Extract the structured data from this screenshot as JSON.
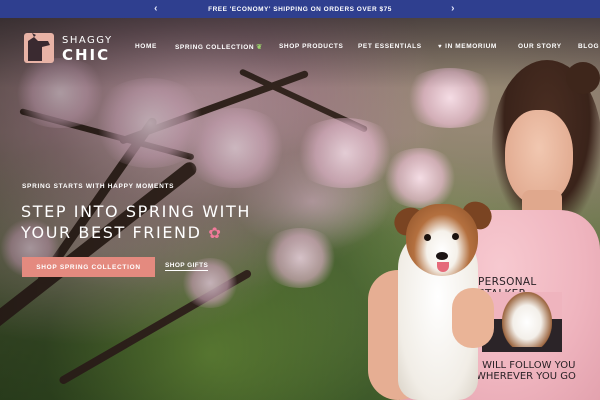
{
  "announcement": {
    "text": "FREE 'ECONOMY' SHIPPING ON ORDERS OVER $75",
    "prev_icon": "chevron-left-icon",
    "next_icon": "chevron-right-icon"
  },
  "brand": {
    "line1": "SHAGGY",
    "line2": "CHIC",
    "logo_icon": "dog-silhouette-icon",
    "accent_color": "#e48a7f"
  },
  "nav": {
    "items": [
      {
        "label": "HOME"
      },
      {
        "label": "SPRING COLLECTION",
        "icon": "sprout-icon"
      },
      {
        "label": "SHOP PRODUCTS"
      },
      {
        "label": "PET ESSENTIALS"
      },
      {
        "label": "IN MEMORIUM",
        "icon": "heart-icon"
      },
      {
        "label": "OUR STORY"
      },
      {
        "label": "BLOG"
      }
    ]
  },
  "hero": {
    "eyebrow": "SPRING STARTS WITH HAPPY MOMENTS",
    "headline_line1": "STEP INTO SPRING WITH",
    "headline_line2": "YOUR BEST FRIEND",
    "headline_icon": "cherry-blossom-icon",
    "primary_cta": "SHOP SPRING COLLECTION",
    "secondary_cta": "SHOP GIFTS",
    "shirt_text_top": "PERSONAL STALKER",
    "shirt_text_bottom": "I WILL FOLLOW YOU WHEREVER YOU GO"
  },
  "colors": {
    "announcement_bg": "#2f3f8f",
    "cta_bg": "#e48a7f",
    "text": "#ffffff"
  }
}
